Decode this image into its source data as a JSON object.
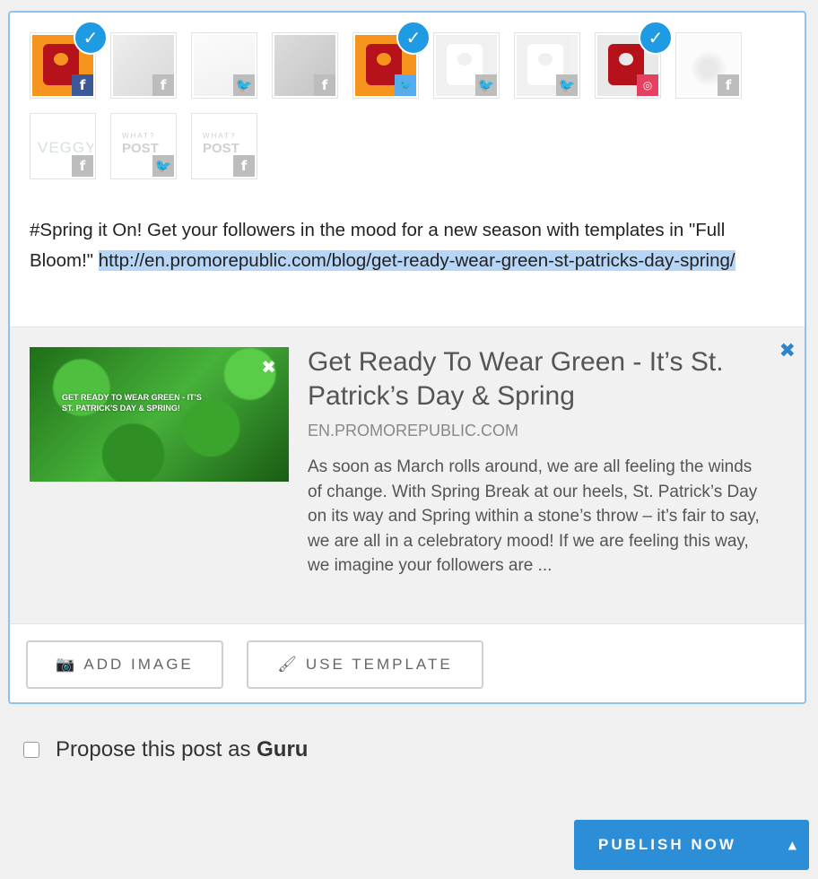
{
  "accounts": [
    {
      "kind": "p-orange",
      "network": "facebook",
      "network_glyph": "f",
      "selected": true
    },
    {
      "kind": "photo",
      "network": "facebook",
      "network_glyph": "f",
      "selected": false
    },
    {
      "kind": "photo2",
      "network": "twitter",
      "network_glyph": "🐦",
      "selected": false
    },
    {
      "kind": "photo3",
      "network": "facebook",
      "network_glyph": "f",
      "selected": false
    },
    {
      "kind": "p-orange",
      "network": "twitter",
      "network_glyph": "🐦",
      "selected": true
    },
    {
      "kind": "p-grey",
      "network": "twitter",
      "network_glyph": "🐦",
      "selected": false
    },
    {
      "kind": "p-grey",
      "network": "twitter",
      "network_glyph": "🐦",
      "selected": false
    },
    {
      "kind": "p-red",
      "network": "instagram",
      "network_glyph": "◎",
      "selected": true
    },
    {
      "kind": "blur",
      "network": "facebook",
      "network_glyph": "f",
      "selected": false
    },
    {
      "kind": "veggy",
      "network": "facebook",
      "network_glyph": "f",
      "selected": false,
      "label": "VEGGY"
    },
    {
      "kind": "post",
      "network": "twitter",
      "network_glyph": "🐦",
      "selected": false,
      "label_top": "WHAT?",
      "label": "POST"
    },
    {
      "kind": "post",
      "network": "facebook",
      "network_glyph": "f",
      "selected": false,
      "label_top": "WHAT?",
      "label": "POST"
    }
  ],
  "message": {
    "text": "#Spring it On! Get your followers in the mood for a new season with templates in \"Full Bloom!\" ",
    "link": "http://en.promorepublic.com/blog/get-ready-wear-green-st-patricks-day-spring/"
  },
  "preview": {
    "image_text": "GET READY TO WEAR GREEN - IT'S ST. PATRICK'S DAY & SPRING!",
    "title": "Get Ready To Wear Green - It’s St. Patrick’s Day & Spring",
    "domain": "EN.PROMOREPUBLIC.COM",
    "description": "As soon as March rolls around, we are all feeling the winds of change. With Spring Break at our heels, St. Patrick’s Day on its way and Spring within a stone’s throw – it’s fair to say, we are all in a celebratory mood! If we are feeling this way, we imagine your followers are ...",
    "close_glyph": "✖",
    "image_close_glyph": "✖"
  },
  "buttons": {
    "add_image": "ADD IMAGE",
    "add_image_icon": "📷",
    "use_template": "USE TEMPLATE",
    "use_template_icon": "🖌"
  },
  "guru": {
    "label": "Propose this post as ",
    "bold": "Guru",
    "checked": false
  },
  "publish": {
    "label": "PUBLISH NOW",
    "caret": "▲"
  },
  "colors": {
    "accent": "#2b8ed6",
    "selected_check": "#1e9be3",
    "link_highlight": "#b7d6f7"
  }
}
